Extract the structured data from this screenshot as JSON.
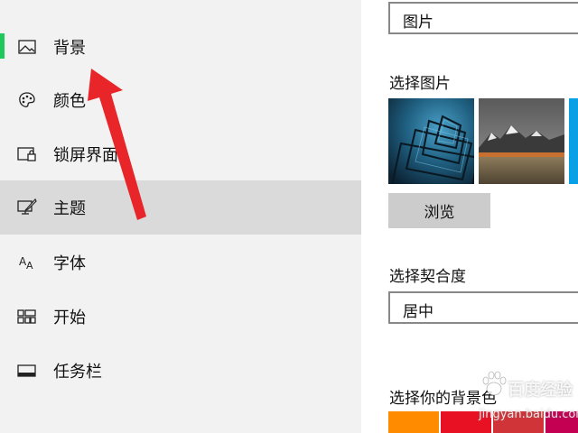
{
  "sidebar": {
    "items": [
      {
        "label": "背景",
        "icon": "picture-icon"
      },
      {
        "label": "颜色",
        "icon": "palette-icon"
      },
      {
        "label": "锁屏界面",
        "icon": "lock-screen-icon"
      },
      {
        "label": "主题",
        "icon": "theme-brush-icon"
      },
      {
        "label": "字体",
        "icon": "font-icon"
      },
      {
        "label": "开始",
        "icon": "start-tiles-icon"
      },
      {
        "label": "任务栏",
        "icon": "taskbar-icon"
      }
    ],
    "selected_indicator_color": "#1ec85a"
  },
  "main": {
    "background_type": {
      "value": "图片"
    },
    "choose_picture": {
      "label": "选择图片",
      "browse_label": "浏览"
    },
    "choose_fit": {
      "label": "选择契合度",
      "value": "居中"
    },
    "choose_background_color": {
      "label": "选择你的背景色",
      "swatch_colors": [
        "#ff8c00",
        "#e81123",
        "#d13438",
        "#c30052"
      ]
    }
  },
  "watermark": {
    "brand": "百度经验",
    "url": "jingyan.baidu.com"
  },
  "colors": {
    "sidebar_bg": "#f2f2f2",
    "hover_bg": "#dadada",
    "arrow": "#e8262a",
    "button_bg": "#cccccc"
  }
}
